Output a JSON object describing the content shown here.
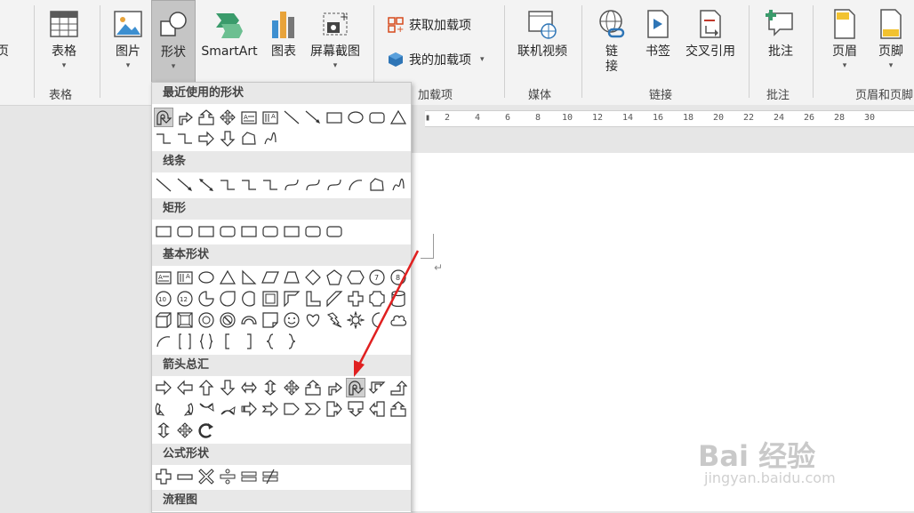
{
  "ribbon": {
    "buttons": {
      "page_partial": "页",
      "table": "表格",
      "picture": "图片",
      "shapes": "形状",
      "smartart": "SmartArt",
      "chart": "图表",
      "screenshot": "屏幕截图",
      "online_video": "联机视频",
      "link": "链\n接",
      "bookmark": "书签",
      "cross_ref": "交叉引用",
      "comment": "批注",
      "header": "页眉",
      "footer": "页脚"
    },
    "small_buttons": {
      "get_addins": "获取加载项",
      "my_addins": "我的加载项"
    },
    "groups": {
      "tables": "表格",
      "addins": "加载项",
      "media": "媒体",
      "links": "链接",
      "comments": "批注",
      "header_footer": "页眉和页脚"
    },
    "accent": "#2e75b6"
  },
  "shapes_menu": {
    "sections": {
      "recent": "最近使用的形状",
      "lines": "线条",
      "rectangles": "矩形",
      "basic": "基本形状",
      "arrows": "箭头总汇",
      "equation": "公式形状",
      "flowchart": "流程图"
    },
    "highlighted_shape": "u-turn-arrow-icon"
  },
  "ruler": {
    "ticks": [
      "2",
      "4",
      "6",
      "8",
      "10",
      "12",
      "14",
      "16",
      "18",
      "20",
      "22",
      "24",
      "26",
      "28",
      "30"
    ]
  },
  "document": {
    "paragraph_mark": "↵"
  },
  "watermark": {
    "brand": "Bai 经验",
    "url": "jingyan.baidu.com"
  },
  "annotation_color": "#e02020"
}
